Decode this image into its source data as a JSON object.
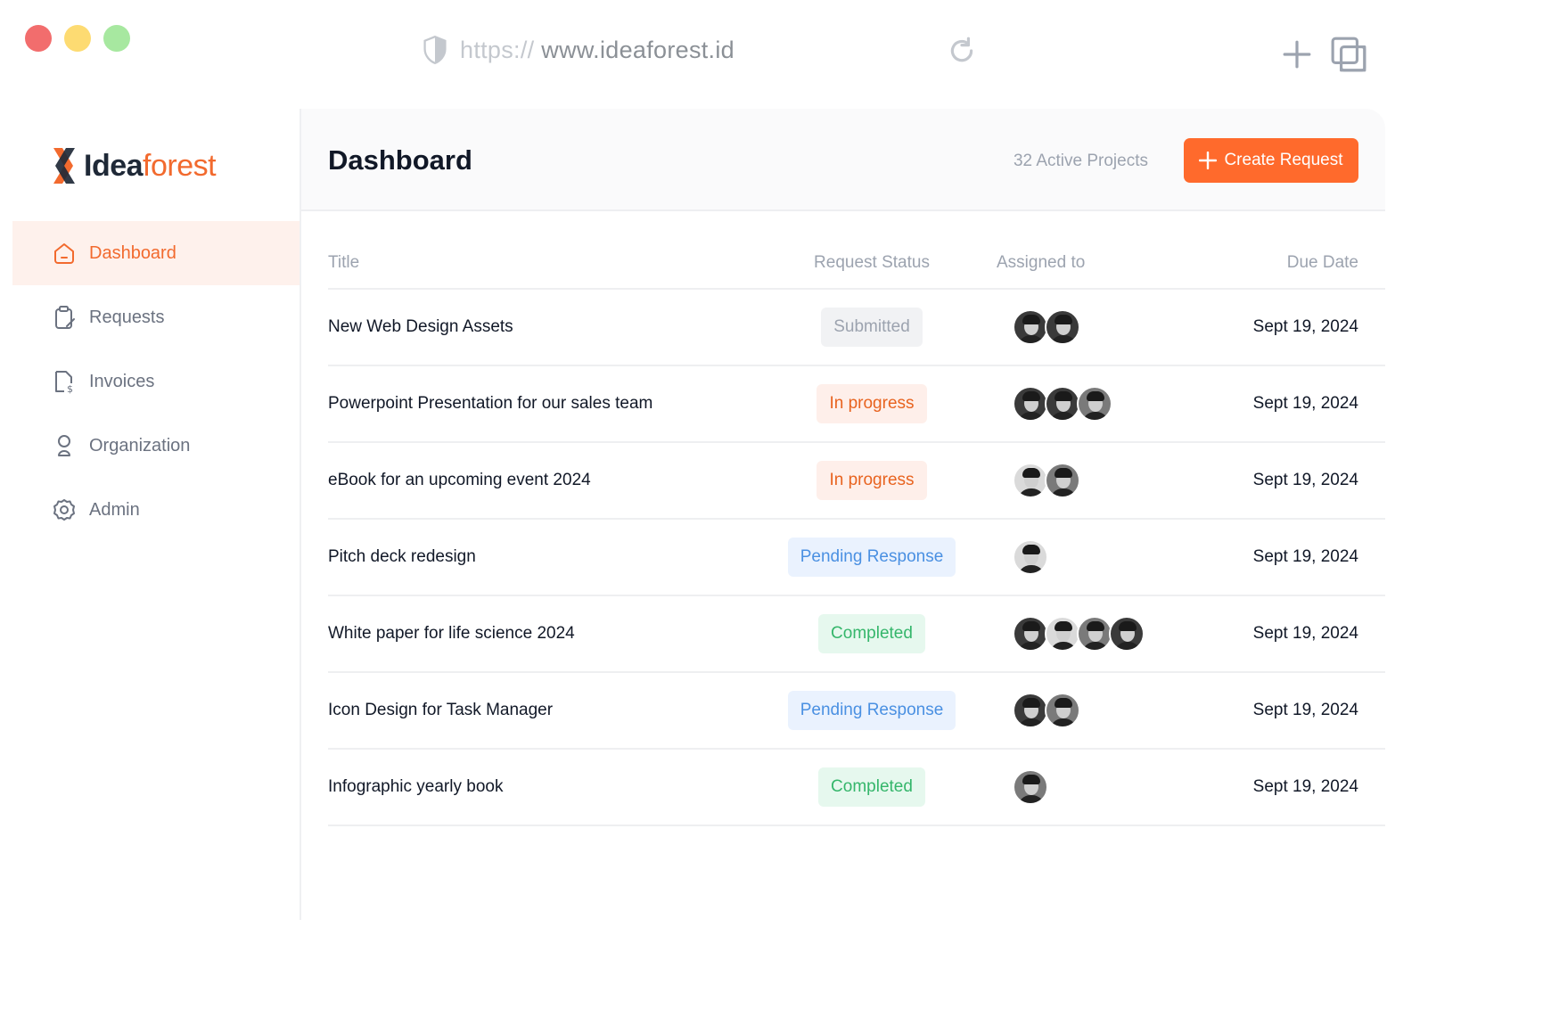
{
  "browser": {
    "url_scheme": "https://",
    "url_host": "www.ideaforest.id",
    "icons": [
      "shield-icon",
      "reload-icon",
      "plus-icon",
      "window-icon"
    ]
  },
  "brand": {
    "name_part1": "Idea",
    "name_part2": "forest",
    "accent": "#F26A2E"
  },
  "sidebar": {
    "items": [
      {
        "label": "Dashboard",
        "icon": "home-icon",
        "active": true
      },
      {
        "label": "Requests",
        "icon": "clipboard-icon",
        "active": false
      },
      {
        "label": "Invoices",
        "icon": "invoice-icon",
        "active": false
      },
      {
        "label": "Organization",
        "icon": "user-icon",
        "active": false
      },
      {
        "label": "Admin",
        "icon": "gear-icon",
        "active": false
      }
    ]
  },
  "header": {
    "title": "Dashboard",
    "active_projects": "32  Active Projects",
    "create_button": "Create Request"
  },
  "table": {
    "columns": [
      "Title",
      "Request Status",
      "Assigned to",
      "Due Date"
    ],
    "rows": [
      {
        "title": "New Web Design Assets",
        "status": "Submitted",
        "due": "Sept 19, 2024"
      },
      {
        "title": "Powerpoint Presentation for our sales team",
        "status": "In progress",
        "due": "Sept 19, 2024"
      },
      {
        "title": "eBook for an upcoming event 2024",
        "status": "In progress",
        "due": "Sept 19, 2024"
      },
      {
        "title": "Pitch deck redesign",
        "status": "Pending Response",
        "due": "Sept 19, 2024"
      },
      {
        "title": "White paper for life science 2024",
        "status": "Completed",
        "due": "Sept 19, 2024"
      },
      {
        "title": "Icon Design for Task Manager",
        "status": "Pending Response",
        "due": "Sept 19, 2024"
      },
      {
        "title": "Infographic yearly book",
        "status": "Completed",
        "due": "Sept 19, 2024"
      }
    ]
  },
  "colors": {
    "submitted": "#9CA3AF",
    "in_progress": "#E8631F",
    "pending": "#4A90E2",
    "completed": "#35B66B",
    "button": "#FF6A2C"
  }
}
